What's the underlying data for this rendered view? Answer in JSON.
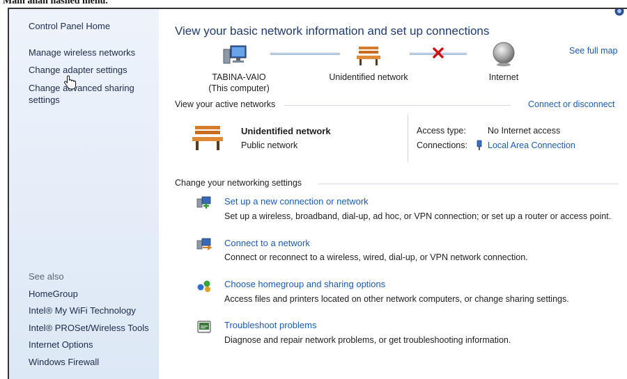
{
  "caption": "Main anan hashed menu.",
  "sidebar": {
    "home": "Control Panel Home",
    "items": [
      {
        "label": "Manage wireless networks"
      },
      {
        "label": "Change adapter settings"
      },
      {
        "label": "Change advanced sharing settings"
      }
    ],
    "see_also": "See also",
    "see_also_items": [
      {
        "label": "HomeGroup"
      },
      {
        "label": "Intel® My WiFi Technology"
      },
      {
        "label": "Intel® PROSet/Wireless Tools"
      },
      {
        "label": "Internet Options"
      },
      {
        "label": "Windows Firewall"
      }
    ]
  },
  "main": {
    "title": "View your basic network information and set up connections",
    "see_full_map": "See full map",
    "map": {
      "computer_name": "TABINA-VAIO",
      "computer_sub": "(This computer)",
      "network": "Unidentified network",
      "internet": "Internet"
    },
    "active_section": "View your active networks",
    "connect_disconnect": "Connect or disconnect",
    "active_network": {
      "name": "Unidentified network",
      "type": "Public network",
      "access_type_label": "Access type:",
      "access_type_value": "No Internet access",
      "connections_label": "Connections:",
      "connections_value": "Local Area Connection"
    },
    "change_section": "Change your networking settings",
    "tasks": [
      {
        "title": "Set up a new connection or network",
        "desc": "Set up a wireless, broadband, dial-up, ad hoc, or VPN connection; or set up a router or access point."
      },
      {
        "title": "Connect to a network",
        "desc": "Connect or reconnect to a wireless, wired, dial-up, or VPN network connection."
      },
      {
        "title": "Choose homegroup and sharing options",
        "desc": "Access files and printers located on other network computers, or change sharing settings."
      },
      {
        "title": "Troubleshoot problems",
        "desc": "Diagnose and repair network problems, or get troubleshooting information."
      }
    ]
  },
  "icons": {
    "computer": "computer-icon",
    "bench": "bench-network-icon",
    "error": "red-x-icon",
    "globe": "globe-icon",
    "adapter": "adapter-icon",
    "help": "help-icon"
  },
  "colors": {
    "link": "#1a5bb5",
    "heading": "#1e3a6e",
    "sidebar": "#e3ecf8",
    "error": "#d01010"
  }
}
